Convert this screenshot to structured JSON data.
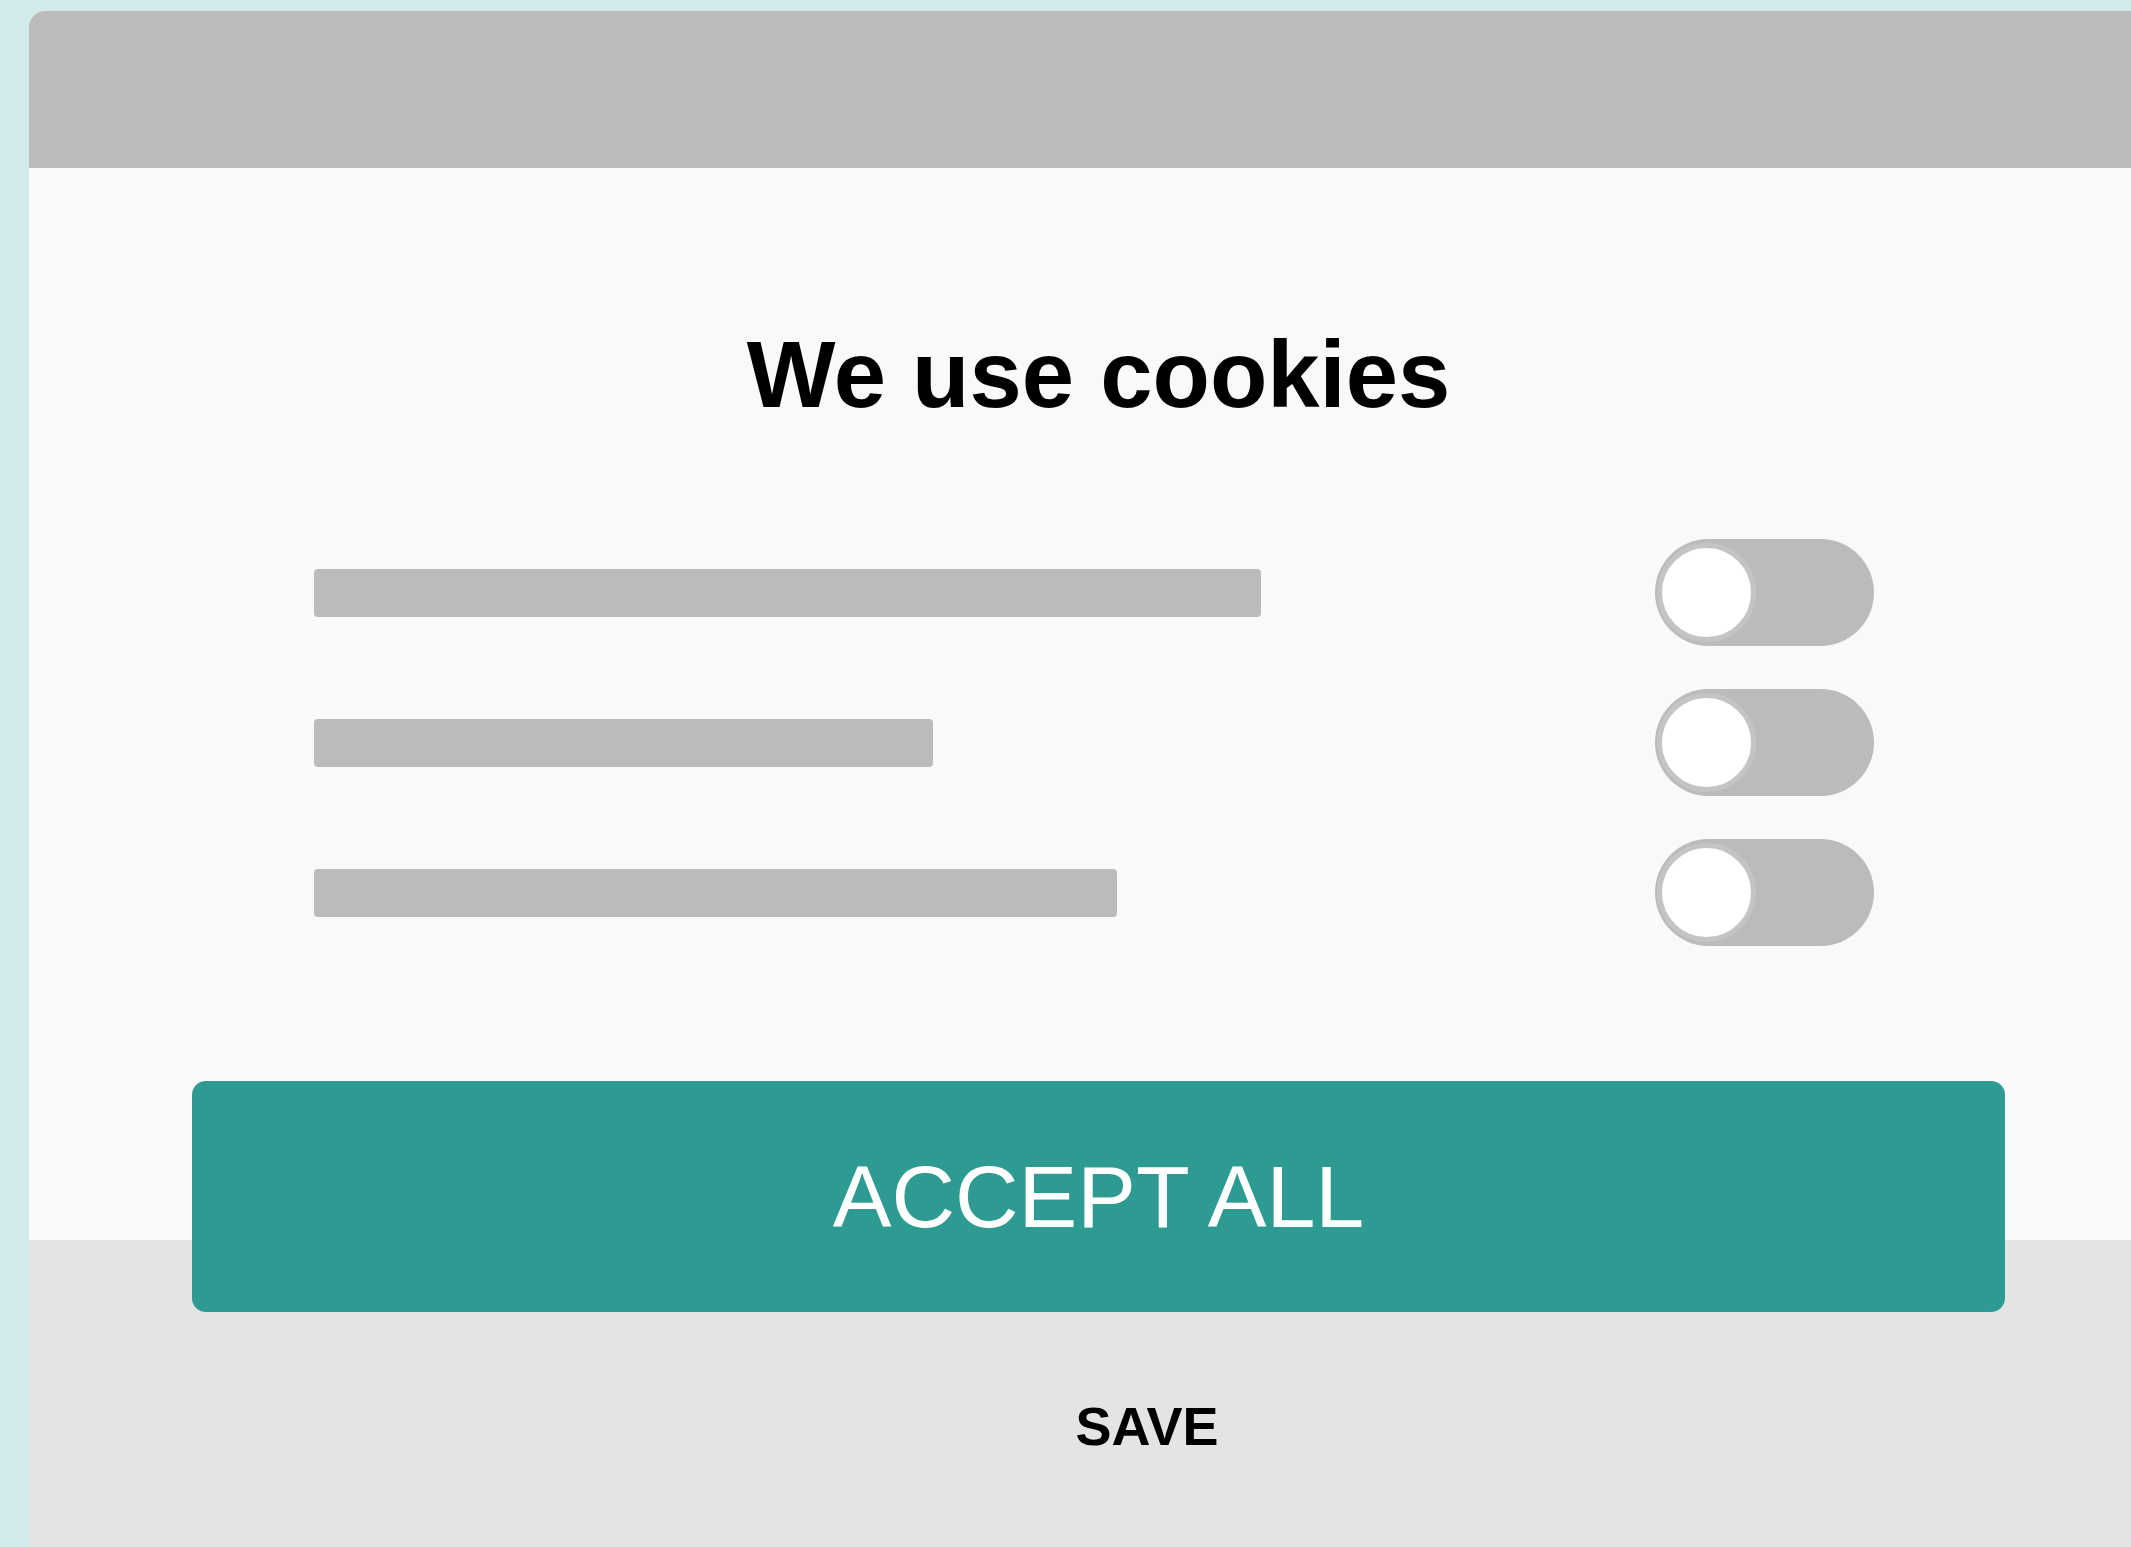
{
  "dialog": {
    "title": "We use cookies",
    "options": [
      {
        "on": false
      },
      {
        "on": false
      },
      {
        "on": false
      }
    ],
    "accept_button": "ACCEPT ALL",
    "save_button": "SAVE"
  }
}
